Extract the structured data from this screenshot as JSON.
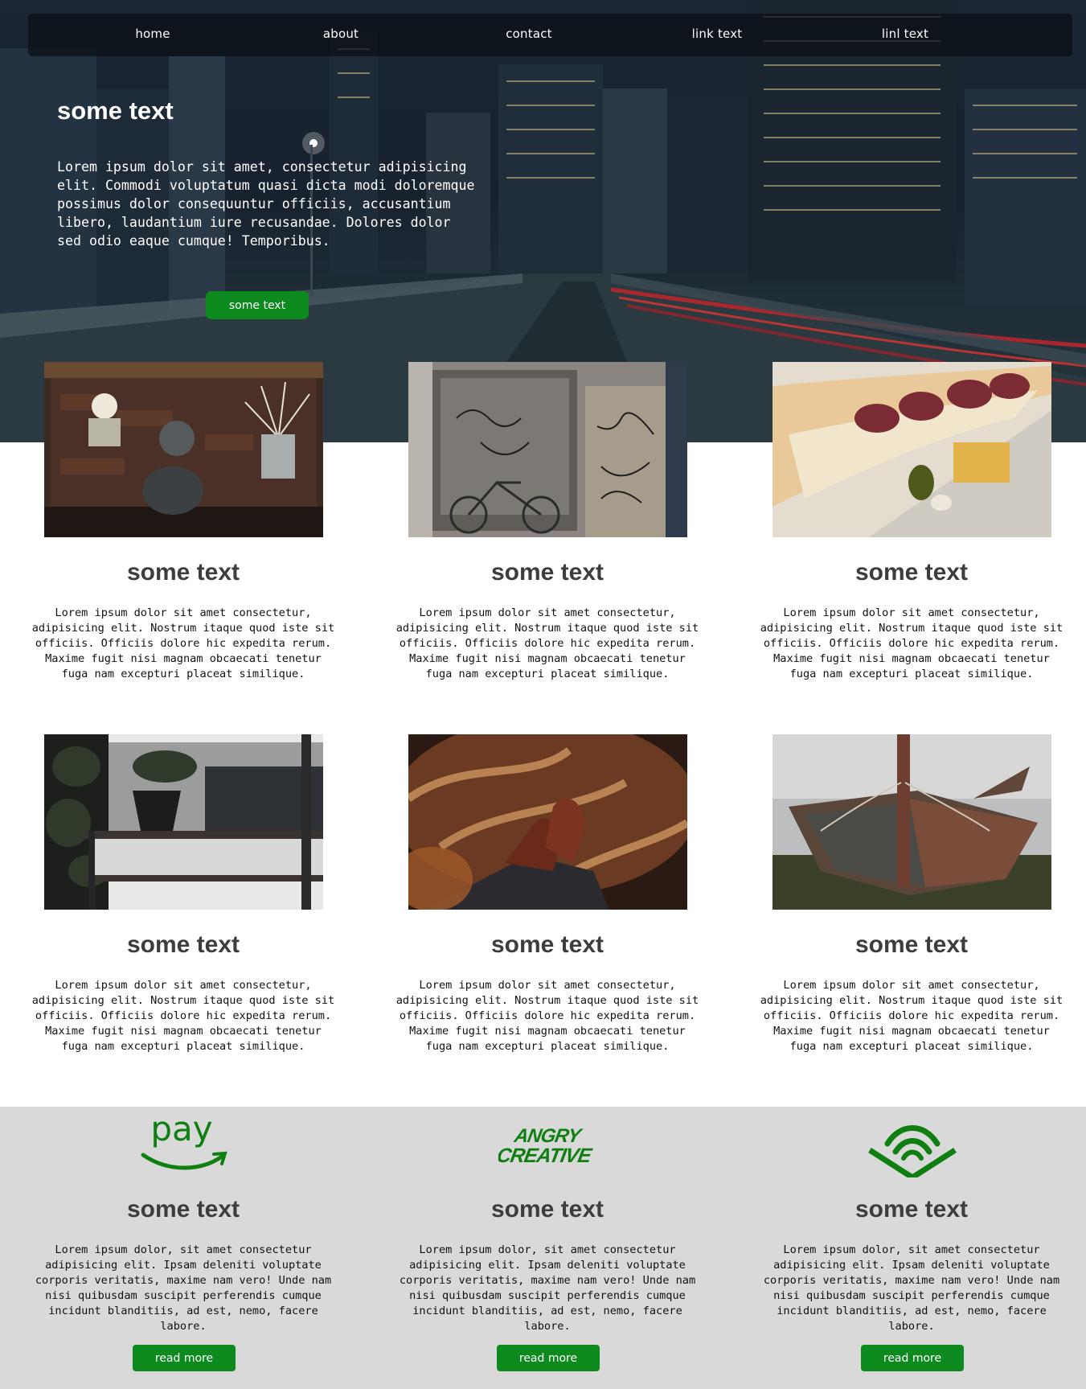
{
  "nav": {
    "items": [
      "home",
      "about",
      "contact",
      "link text",
      "linl text"
    ]
  },
  "hero": {
    "title": "some text",
    "text": "Lorem ipsum dolor sit amet, consectetur adipisicing elit. Commodi voluptatum quasi dicta modi doloremque possimus dolor consequuntur officiis, accusantium libero, laudantium iure recusandae. Dolores dolor sed odio eaque cumque! Temporibus.",
    "button_label": "some text"
  },
  "cards": [
    {
      "title": "some text",
      "text": "Lorem ipsum dolor sit amet consectetur, adipisicing elit. Nostrum itaque quod iste sit officiis. Officiis dolore hic expedita rerum. Maxime fugit nisi magnam obcaecati tenetur fuga nam excepturi placeat similique.",
      "image": "kettle-shelf-photo"
    },
    {
      "title": "some text",
      "text": "Lorem ipsum dolor sit amet consectetur, adipisicing elit. Nostrum itaque quod iste sit officiis. Officiis dolore hic expedita rerum. Maxime fugit nisi magnam obcaecati tenetur fuga nam excepturi placeat similique.",
      "image": "graffiti-door-bicycle-photo"
    },
    {
      "title": "some text",
      "text": "Lorem ipsum dolor sit amet consectetur, adipisicing elit. Nostrum itaque quod iste sit officiis. Officiis dolore hic expedita rerum. Maxime fugit nisi magnam obcaecati tenetur fuga nam excepturi placeat similique.",
      "image": "baguette-salami-photo"
    },
    {
      "title": "some text",
      "text": "Lorem ipsum dolor sit amet consectetur, adipisicing elit. Nostrum itaque quod iste sit officiis. Officiis dolore hic expedita rerum. Maxime fugit nisi magnam obcaecati tenetur fuga nam excepturi placeat similique.",
      "image": "plant-window-photo"
    },
    {
      "title": "some text",
      "text": "Lorem ipsum dolor sit amet consectetur, adipisicing elit. Nostrum itaque quod iste sit officiis. Officiis dolore hic expedita rerum. Maxime fugit nisi magnam obcaecati tenetur fuga nam excepturi placeat similique.",
      "image": "leather-shoes-photo"
    },
    {
      "title": "some text",
      "text": "Lorem ipsum dolor sit amet consectetur, adipisicing elit. Nostrum itaque quod iste sit officiis. Officiis dolore hic expedita rerum. Maxime fugit nisi magnam obcaecati tenetur fuga nam excepturi placeat similique.",
      "image": "wrecked-boat-photo"
    }
  ],
  "partners": [
    {
      "logo_text": "pay",
      "logo": "amazon-pay-logo",
      "title": "some text",
      "text": "Lorem ipsum dolor, sit amet consectetur adipisicing elit. Ipsam deleniti voluptate corporis veritatis, maxime nam vero! Unde nam nisi quibusdam suscipit perferendis cumque incidunt blanditiis, ad est, nemo, facere labore.",
      "button_label": "read more"
    },
    {
      "logo_text": "ANGRY CREATIVE",
      "logo": "angry-creative-logo",
      "title": "some text",
      "text": "Lorem ipsum dolor, sit amet consectetur adipisicing elit. Ipsam deleniti voluptate corporis veritatis, maxime nam vero! Unde nam nisi quibusdam suscipit perferendis cumque incidunt blanditiis, ad est, nemo, facere labore.",
      "button_label": "read more"
    },
    {
      "logo_text": "",
      "logo": "audible-logo",
      "title": "some text",
      "text": "Lorem ipsum dolor, sit amet consectetur adipisicing elit. Ipsam deleniti voluptate corporis veritatis, maxime nam vero! Unde nam nisi quibusdam suscipit perferendis cumque incidunt blanditiis, ad est, nemo, facere labore.",
      "button_label": "read more"
    }
  ],
  "colors": {
    "accent": "#0c8a1d",
    "heading": "#3d3d3d",
    "section_grey": "#d9d9d9",
    "logo_green": "#0f7f12"
  }
}
